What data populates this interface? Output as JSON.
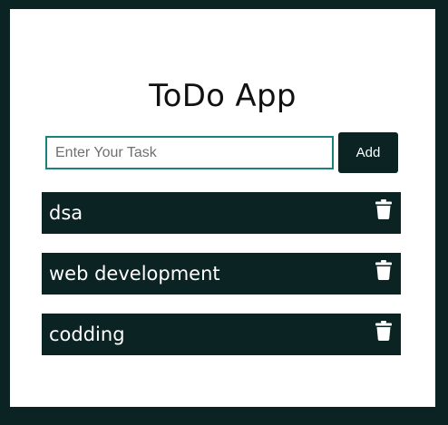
{
  "app": {
    "title": "ToDo App"
  },
  "form": {
    "input_value": "",
    "input_placeholder": "Enter Your Task",
    "add_label": "Add"
  },
  "tasks": [
    {
      "text": "dsa"
    },
    {
      "text": "web development"
    },
    {
      "text": "codding"
    }
  ],
  "colors": {
    "background": "#0b2323",
    "card": "#ffffff",
    "input_border": "#17837a",
    "task_bg": "#0b2323",
    "task_text": "#ffffff"
  },
  "icons": {
    "delete": "trash-icon"
  }
}
